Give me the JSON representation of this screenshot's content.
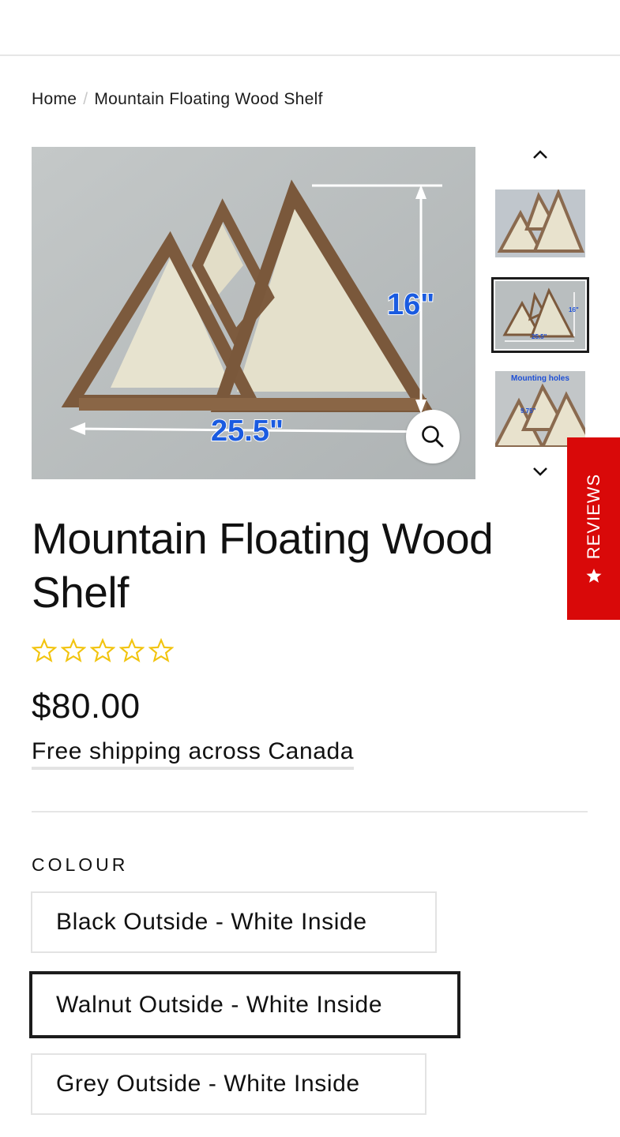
{
  "breadcrumb": {
    "home": "Home",
    "separator": "/",
    "current": "Mountain Floating Wood Shelf"
  },
  "gallery": {
    "main_image": {
      "dim_height": "16\"",
      "dim_width": "25.5\""
    },
    "zoom_icon": "search-icon",
    "thumbnails": [
      {
        "label": ""
      },
      {
        "dim_height": "16\"",
        "dim_width": "25.5\""
      },
      {
        "label": "Mounting holes",
        "dim": "9.75\""
      }
    ],
    "prev_icon": "chevron-up-icon",
    "next_icon": "chevron-down-icon"
  },
  "reviews_tab": {
    "label": "REVIEWS",
    "icon": "star-icon",
    "color": "#d90909"
  },
  "product": {
    "title": "Mountain Floating Wood Shelf",
    "rating": 0,
    "rating_max": 5,
    "star_color": "#f2c40f",
    "price": "$80.00",
    "shipping": "Free shipping across Canada"
  },
  "options": {
    "label": "COLOUR",
    "values": [
      {
        "label": "Black Outside - White Inside",
        "selected": false
      },
      {
        "label": "Walnut Outside - White Inside",
        "selected": true
      },
      {
        "label": "Grey Outside - White Inside",
        "selected": false
      }
    ]
  }
}
